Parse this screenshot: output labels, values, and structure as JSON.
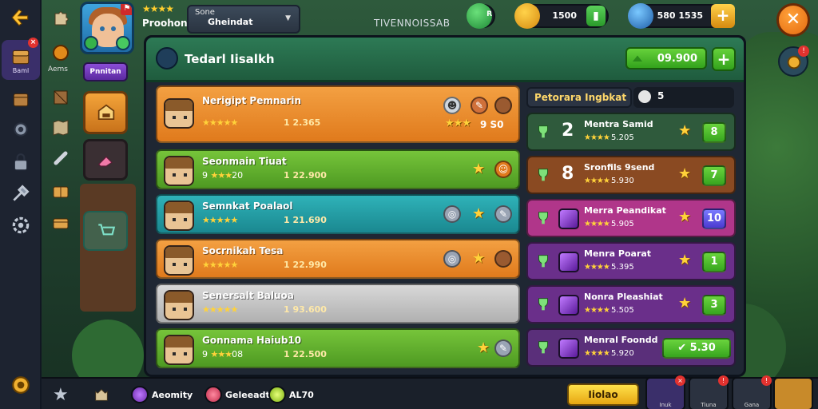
{
  "topbar": {
    "player_stars": "★★★★",
    "player_name": "Proohont",
    "guild_small": "Sone",
    "guild_main": "Gheindat",
    "server_title": "TIVENNOISSAB",
    "gem_badge": "R",
    "gold_value": "1500",
    "crystal_value": "580 1535"
  },
  "left_rail": {
    "active_label": "Baml",
    "secondary_label": "Aems"
  },
  "side_panel": {
    "purple_pill": "Pnnitan"
  },
  "panel": {
    "title": "Tedarl Iisalkh",
    "header_value": "09.900"
  },
  "left_list": [
    {
      "name": "Nerigipt Pemnarin",
      "stars": "★★★★★",
      "stars_text": "",
      "power": "1 2.365",
      "tail": "9 S0",
      "color": "orange"
    },
    {
      "name": "Seonmain Tiuat",
      "stars": "★★★",
      "stars_text": "9 ",
      "stars_after": "20",
      "power": "1 22.900",
      "tail": "",
      "color": "green"
    },
    {
      "name": "Semnkat Poalaol",
      "stars": "★★★★★",
      "stars_text": "",
      "power": "1 21.690",
      "tail": "",
      "color": "teal"
    },
    {
      "name": "Socrnikah Tesa",
      "stars": "★★★★★",
      "stars_text": "",
      "power": "1 22.990",
      "tail": "",
      "color": "orange"
    },
    {
      "name": "Senersalt Baluoa",
      "stars": "★★★★★",
      "stars_text": "",
      "power": "1 93.600",
      "tail": "",
      "color": "grey"
    },
    {
      "name": "Gonnama Haiub10",
      "stars": "★★★",
      "stars_text": "9 ",
      "stars_after": "08",
      "power": "1 22.500",
      "tail": "",
      "color": "green"
    }
  ],
  "right_list": {
    "header_tab": "Petorara Ingbkat",
    "header_count": "5",
    "rows": [
      {
        "rank": "2",
        "name": "Mentra Samid",
        "stars": "★★★★",
        "value": "5.205",
        "button": "8",
        "color": "#2f5a3c"
      },
      {
        "rank": "8",
        "name": "Sronfils 9send",
        "stars": "★★★★",
        "value": "5.930",
        "button": "7",
        "color": "#8a4a22"
      },
      {
        "rank": "",
        "name": "Merra Peandikat",
        "stars": "★★★★",
        "value": "5.905",
        "button": "10",
        "color": "#b0368a"
      },
      {
        "rank": "",
        "name": "Menra Poarat",
        "stars": "★★★★",
        "value": "5.395",
        "button": "1",
        "color": "#6a2f8a"
      },
      {
        "rank": "",
        "name": "Nonra Pleashiat",
        "stars": "★★★★",
        "value": "5.505",
        "button": "3",
        "color": "#6a2f8a"
      },
      {
        "rank": "",
        "name": "Menral Foondd",
        "stars": "★★★★",
        "value": "5.920",
        "button": "5.30",
        "color": "#5a2f7a"
      }
    ]
  },
  "bottombar": {
    "item1": "Aeomity",
    "item2": "Geleeadt",
    "item3": "AL70",
    "yellow_button": "Iiolao",
    "tab_labels": [
      "Inuk",
      "Tiuna",
      "Gana",
      ""
    ]
  }
}
